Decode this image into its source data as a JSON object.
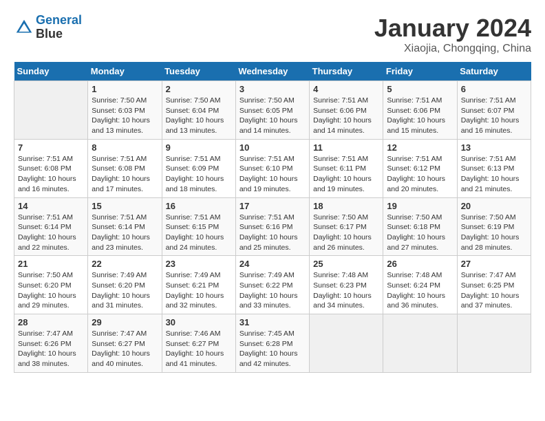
{
  "header": {
    "logo_line1": "General",
    "logo_line2": "Blue",
    "month": "January 2024",
    "location": "Xiaojia, Chongqing, China"
  },
  "weekdays": [
    "Sunday",
    "Monday",
    "Tuesday",
    "Wednesday",
    "Thursday",
    "Friday",
    "Saturday"
  ],
  "weeks": [
    [
      {
        "day": "",
        "empty": true
      },
      {
        "day": "1",
        "sunrise": "7:50 AM",
        "sunset": "6:03 PM",
        "daylight": "10 hours and 13 minutes."
      },
      {
        "day": "2",
        "sunrise": "7:50 AM",
        "sunset": "6:04 PM",
        "daylight": "10 hours and 13 minutes."
      },
      {
        "day": "3",
        "sunrise": "7:50 AM",
        "sunset": "6:05 PM",
        "daylight": "10 hours and 14 minutes."
      },
      {
        "day": "4",
        "sunrise": "7:51 AM",
        "sunset": "6:06 PM",
        "daylight": "10 hours and 14 minutes."
      },
      {
        "day": "5",
        "sunrise": "7:51 AM",
        "sunset": "6:06 PM",
        "daylight": "10 hours and 15 minutes."
      },
      {
        "day": "6",
        "sunrise": "7:51 AM",
        "sunset": "6:07 PM",
        "daylight": "10 hours and 16 minutes."
      }
    ],
    [
      {
        "day": "7",
        "sunrise": "7:51 AM",
        "sunset": "6:08 PM",
        "daylight": "10 hours and 16 minutes."
      },
      {
        "day": "8",
        "sunrise": "7:51 AM",
        "sunset": "6:08 PM",
        "daylight": "10 hours and 17 minutes."
      },
      {
        "day": "9",
        "sunrise": "7:51 AM",
        "sunset": "6:09 PM",
        "daylight": "10 hours and 18 minutes."
      },
      {
        "day": "10",
        "sunrise": "7:51 AM",
        "sunset": "6:10 PM",
        "daylight": "10 hours and 19 minutes."
      },
      {
        "day": "11",
        "sunrise": "7:51 AM",
        "sunset": "6:11 PM",
        "daylight": "10 hours and 19 minutes."
      },
      {
        "day": "12",
        "sunrise": "7:51 AM",
        "sunset": "6:12 PM",
        "daylight": "10 hours and 20 minutes."
      },
      {
        "day": "13",
        "sunrise": "7:51 AM",
        "sunset": "6:13 PM",
        "daylight": "10 hours and 21 minutes."
      }
    ],
    [
      {
        "day": "14",
        "sunrise": "7:51 AM",
        "sunset": "6:14 PM",
        "daylight": "10 hours and 22 minutes."
      },
      {
        "day": "15",
        "sunrise": "7:51 AM",
        "sunset": "6:14 PM",
        "daylight": "10 hours and 23 minutes."
      },
      {
        "day": "16",
        "sunrise": "7:51 AM",
        "sunset": "6:15 PM",
        "daylight": "10 hours and 24 minutes."
      },
      {
        "day": "17",
        "sunrise": "7:51 AM",
        "sunset": "6:16 PM",
        "daylight": "10 hours and 25 minutes."
      },
      {
        "day": "18",
        "sunrise": "7:50 AM",
        "sunset": "6:17 PM",
        "daylight": "10 hours and 26 minutes."
      },
      {
        "day": "19",
        "sunrise": "7:50 AM",
        "sunset": "6:18 PM",
        "daylight": "10 hours and 27 minutes."
      },
      {
        "day": "20",
        "sunrise": "7:50 AM",
        "sunset": "6:19 PM",
        "daylight": "10 hours and 28 minutes."
      }
    ],
    [
      {
        "day": "21",
        "sunrise": "7:50 AM",
        "sunset": "6:20 PM",
        "daylight": "10 hours and 29 minutes."
      },
      {
        "day": "22",
        "sunrise": "7:49 AM",
        "sunset": "6:20 PM",
        "daylight": "10 hours and 31 minutes."
      },
      {
        "day": "23",
        "sunrise": "7:49 AM",
        "sunset": "6:21 PM",
        "daylight": "10 hours and 32 minutes."
      },
      {
        "day": "24",
        "sunrise": "7:49 AM",
        "sunset": "6:22 PM",
        "daylight": "10 hours and 33 minutes."
      },
      {
        "day": "25",
        "sunrise": "7:48 AM",
        "sunset": "6:23 PM",
        "daylight": "10 hours and 34 minutes."
      },
      {
        "day": "26",
        "sunrise": "7:48 AM",
        "sunset": "6:24 PM",
        "daylight": "10 hours and 36 minutes."
      },
      {
        "day": "27",
        "sunrise": "7:47 AM",
        "sunset": "6:25 PM",
        "daylight": "10 hours and 37 minutes."
      }
    ],
    [
      {
        "day": "28",
        "sunrise": "7:47 AM",
        "sunset": "6:26 PM",
        "daylight": "10 hours and 38 minutes."
      },
      {
        "day": "29",
        "sunrise": "7:47 AM",
        "sunset": "6:27 PM",
        "daylight": "10 hours and 40 minutes."
      },
      {
        "day": "30",
        "sunrise": "7:46 AM",
        "sunset": "6:27 PM",
        "daylight": "10 hours and 41 minutes."
      },
      {
        "day": "31",
        "sunrise": "7:45 AM",
        "sunset": "6:28 PM",
        "daylight": "10 hours and 42 minutes."
      },
      {
        "day": "",
        "empty": true
      },
      {
        "day": "",
        "empty": true
      },
      {
        "day": "",
        "empty": true
      }
    ]
  ],
  "labels": {
    "sunrise_prefix": "Sunrise: ",
    "sunset_prefix": "Sunset: ",
    "daylight_prefix": "Daylight: "
  }
}
